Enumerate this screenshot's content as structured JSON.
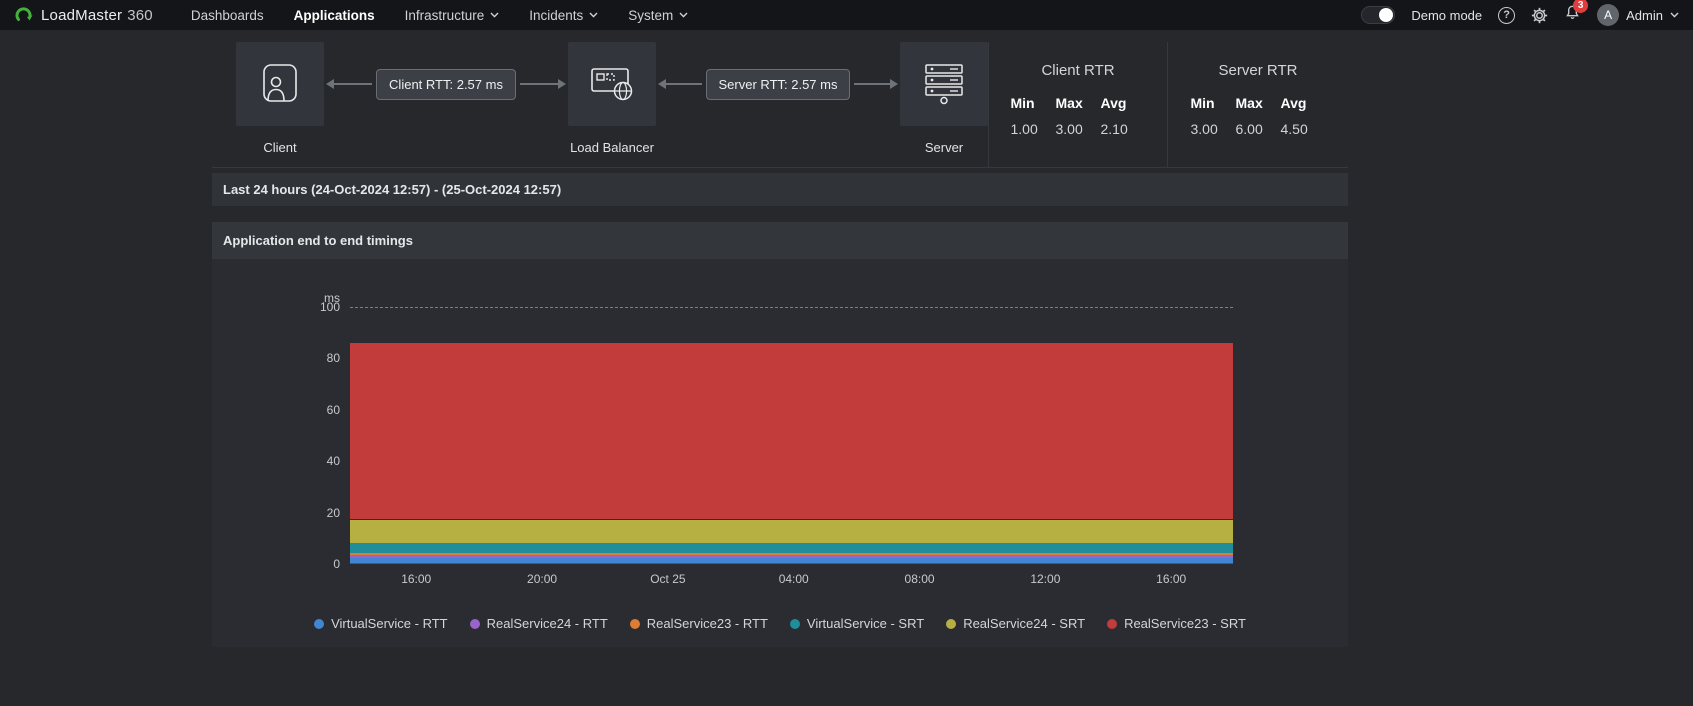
{
  "nav": {
    "brand": {
      "name": "LoadMaster",
      "suffix": "360"
    },
    "items": [
      {
        "label": "Dashboards",
        "active": false,
        "dropdown": false
      },
      {
        "label": "Applications",
        "active": true,
        "dropdown": false
      },
      {
        "label": "Infrastructure",
        "active": false,
        "dropdown": true
      },
      {
        "label": "Incidents",
        "active": false,
        "dropdown": true
      },
      {
        "label": "System",
        "active": false,
        "dropdown": true
      }
    ],
    "demo_mode_label": "Demo mode",
    "notification_count": "3",
    "user": {
      "initial": "A",
      "name": "Admin"
    }
  },
  "topology": {
    "nodes": [
      {
        "label": "Client"
      },
      {
        "label": "Load Balancer"
      },
      {
        "label": "Server"
      }
    ],
    "links": [
      {
        "label": "Client RTT: 2.57 ms"
      },
      {
        "label": "Server RTT: 2.57 ms"
      }
    ]
  },
  "stats": {
    "client": {
      "title": "Client RTR",
      "headers": [
        "Min",
        "Max",
        "Avg"
      ],
      "values": [
        "1.00",
        "3.00",
        "2.10"
      ]
    },
    "server": {
      "title": "Server RTR",
      "headers": [
        "Min",
        "Max",
        "Avg"
      ],
      "values": [
        "3.00",
        "6.00",
        "4.50"
      ]
    }
  },
  "time_range": "Last 24 hours (24-Oct-2024 12:57) - (25-Oct-2024 12:57)",
  "panel": {
    "title": "Application end to end timings"
  },
  "chart_data": {
    "type": "area",
    "stacked": true,
    "title": "Application end to end timings",
    "xlabel": "",
    "ylabel": "ms",
    "unit_label": "ms",
    "ylim": [
      0,
      100
    ],
    "y_ticks": [
      0,
      20,
      40,
      60,
      80,
      100
    ],
    "grid_dashed_at": 100,
    "legend_position": "bottom",
    "x": [
      "16:00",
      "20:00",
      "Oct 25",
      "04:00",
      "08:00",
      "12:00",
      "16:00"
    ],
    "series": [
      {
        "name": "VirtualService - RTT",
        "color": "#4285d3",
        "values": [
          2,
          2,
          2,
          2,
          2,
          2,
          2
        ]
      },
      {
        "name": "RealService24 - RTT",
        "color": "#9a63c9",
        "values": [
          1,
          1,
          1,
          1,
          1,
          1,
          1
        ]
      },
      {
        "name": "RealService23 - RTT",
        "color": "#dd7c33",
        "values": [
          1,
          1,
          1,
          1,
          1,
          1,
          1
        ]
      },
      {
        "name": "VirtualService - SRT",
        "color": "#1f8e99",
        "values": [
          4,
          4,
          4,
          4,
          4,
          4,
          4
        ]
      },
      {
        "name": "RealService24 - SRT",
        "color": "#b6b042",
        "values": [
          9,
          9,
          9,
          9,
          9,
          9,
          9
        ]
      },
      {
        "name": "RealService23 - SRT",
        "color": "#c33c3c",
        "values": [
          69,
          69,
          69,
          69,
          69,
          69,
          69
        ]
      }
    ]
  }
}
